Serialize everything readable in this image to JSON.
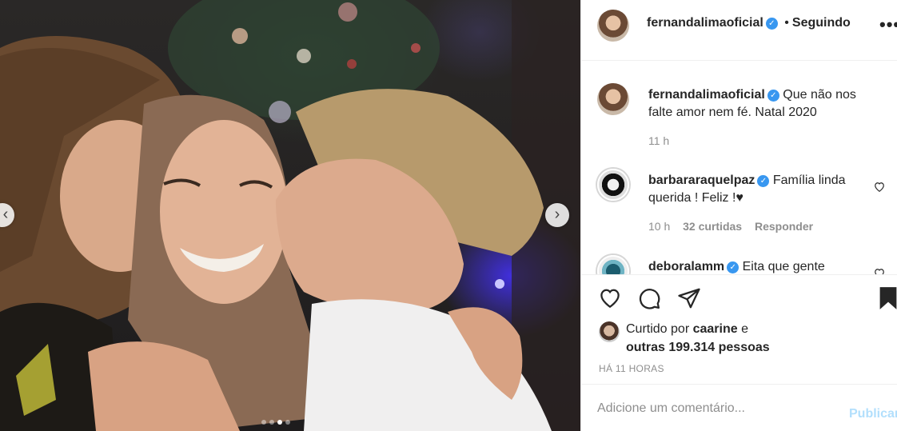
{
  "post": {
    "author": "fernandalimaoficial",
    "follow_status": "Seguindo",
    "more_label": "•••",
    "separator": "•",
    "verified_mark": "✓"
  },
  "carousel": {
    "prev_label": "‹",
    "next_label": "›",
    "slide_count": 4,
    "active_slide": 3
  },
  "comments": [
    {
      "username": "fernandalimaoficial",
      "text": "Que não nos falte amor nem fé. Natal 2020",
      "time": "11 h",
      "verified": true
    },
    {
      "username": "barbararaquelpaz",
      "text": "Família linda querida ! Feliz !♥",
      "time": "10 h",
      "likes": "32 curtidas",
      "reply": "Responder",
      "verified": true
    },
    {
      "username": "deboralamm",
      "text": "Eita que gente",
      "verified": true
    }
  ],
  "likes": {
    "prefix": "Curtido por",
    "user": "caarine",
    "conjunction": "e",
    "others": "outras 199.314 pessoas"
  },
  "timestamp": "HÁ 11 HORAS",
  "add_comment": {
    "placeholder": "Adicione um comentário...",
    "publish": "Publicar"
  },
  "icons": {
    "like": "heart-outline-icon",
    "comment": "comment-bubble-icon",
    "share": "paper-plane-icon",
    "save": "bookmark-filled-icon",
    "comment_like": "heart-small-icon"
  },
  "colors": {
    "accent_blue": "#3897f0",
    "publish_disabled": "#b2dffc",
    "muted_text": "#8e8e8e",
    "divider": "#efefef"
  }
}
